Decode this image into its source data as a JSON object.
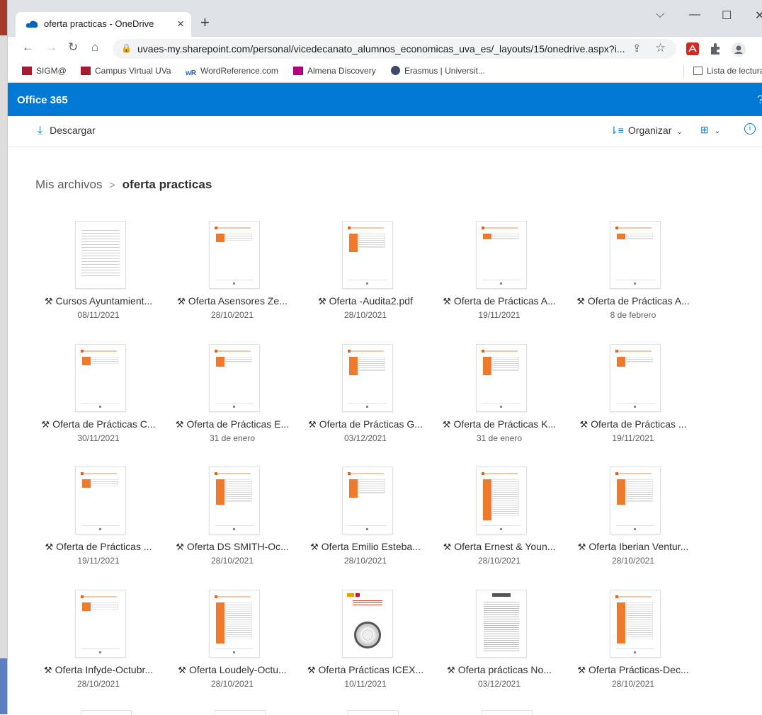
{
  "browser": {
    "tab_title": "oferta practicas - OneDrive",
    "tab_close": "×",
    "new_tab": "+",
    "win_min": "—",
    "win_max": "☐",
    "win_close": "✕",
    "win_chevron": "⌵",
    "url": "uvaes-my.sharepoint.com/personal/vicedecanato_alumnos_economicas_uva_es/_layouts/15/onedrive.aspx?i...",
    "bookmarks": [
      {
        "label": "SIGM@",
        "icon": "uva-icon",
        "color": "#a6192e"
      },
      {
        "label": "Campus Virtual UVa",
        "icon": "uva-icon",
        "color": "#a6192e"
      },
      {
        "label": "WordReference.com",
        "icon": "wordreference-icon",
        "color": "#1a5fb4"
      },
      {
        "label": "Almena Discovery",
        "icon": "almena-icon",
        "color": "#b5007f"
      },
      {
        "label": "Erasmus | Universit...",
        "icon": "erasmus-icon",
        "color": "#3c4a6e"
      },
      {
        "label": "Lista de lectura",
        "icon": "reading-list-icon",
        "color": "#5f6368"
      }
    ]
  },
  "office": {
    "brand": "Office 365",
    "help": "?"
  },
  "commands": {
    "download": "Descargar",
    "sort": "Organizar",
    "view_icon": "grid-view-icon",
    "info_icon": "info-icon"
  },
  "breadcrumb": {
    "root": "Mis archivos",
    "separator": ">",
    "current": "oferta practicas"
  },
  "files": [
    {
      "name": "Cursos Ayuntamient...",
      "date": "08/11/2021",
      "thumb": "text"
    },
    {
      "name": "Oferta Asensores Ze...",
      "date": "28/10/2021",
      "thumb": "form-short"
    },
    {
      "name": "Oferta -Audita2.pdf",
      "date": "28/10/2021",
      "thumb": "form-mid"
    },
    {
      "name": "Oferta de Prácticas A...",
      "date": "19/11/2021",
      "thumb": "form-light"
    },
    {
      "name": "Oferta de Prácticas A...",
      "date": "8 de febrero",
      "thumb": "form-light"
    },
    {
      "name": "Oferta de Prácticas C...",
      "date": "30/11/2021",
      "thumb": "form-short"
    },
    {
      "name": "Oferta de Prácticas E...",
      "date": "31 de enero",
      "thumb": "form-tiny"
    },
    {
      "name": "Oferta de Prácticas G...",
      "date": "03/12/2021",
      "thumb": "form-mid"
    },
    {
      "name": "Oferta de Prácticas K...",
      "date": "31 de enero",
      "thumb": "form-mid"
    },
    {
      "name": "Oferta de Prácticas ...",
      "date": "19/11/2021",
      "thumb": "form-tiny"
    },
    {
      "name": "Oferta de Prácticas ...",
      "date": "19/11/2021",
      "thumb": "form-short"
    },
    {
      "name": "Oferta DS SMITH-Oc...",
      "date": "28/10/2021",
      "thumb": "form-long"
    },
    {
      "name": "Oferta Emilio Esteba...",
      "date": "28/10/2021",
      "thumb": "form-mid"
    },
    {
      "name": "Oferta Ernest & Youn...",
      "date": "28/10/2021",
      "thumb": "form-full"
    },
    {
      "name": "Oferta Iberian Ventur...",
      "date": "28/10/2021",
      "thumb": "form-long"
    },
    {
      "name": "Oferta Infyde-Octubr...",
      "date": "28/10/2021",
      "thumb": "form-short"
    },
    {
      "name": "Oferta Loudely-Octu...",
      "date": "28/10/2021",
      "thumb": "form-full"
    },
    {
      "name": "Oferta Prácticas ICEX...",
      "date": "10/11/2021",
      "thumb": "icex"
    },
    {
      "name": "Oferta prácticas No...",
      "date": "03/12/2021",
      "thumb": "doc"
    },
    {
      "name": "Oferta Prácticas-Dec...",
      "date": "28/10/2021",
      "thumb": "form-full"
    }
  ]
}
